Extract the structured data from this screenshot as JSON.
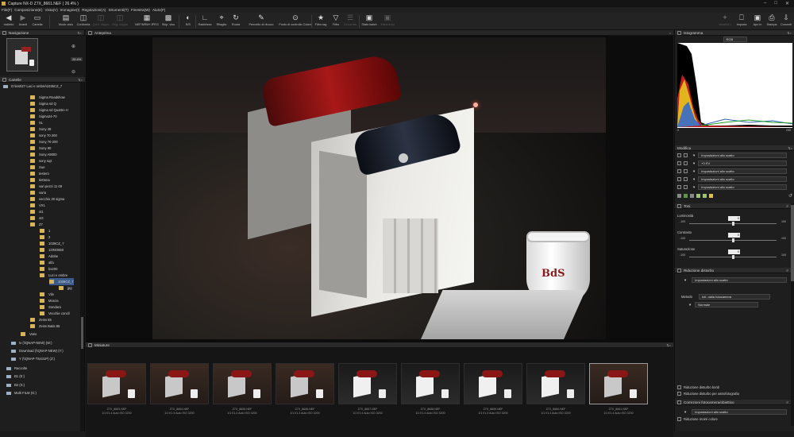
{
  "window": {
    "title": "Capture NX-D    Z7X_8661.NEF ( 26.4% )"
  },
  "menu": [
    "File(F)",
    "Composizione(E)",
    "Vista(V)",
    "Immagine(I)",
    "Regolazioni(A)",
    "Strumenti(T)",
    "Finestra(W)",
    "Aiuto(F)"
  ],
  "toolbar": {
    "items": [
      {
        "label": "Indietro",
        "icon": "back-arrow-icon"
      },
      {
        "label": "Avanti",
        "icon": "forward-arrow-icon"
      },
      {
        "label": "Cartella",
        "icon": "folder-icon"
      },
      {
        "label": "Modo visio",
        "icon": "view-mode-icon"
      },
      {
        "label": "Confronta",
        "icon": "compare-icon"
      },
      {
        "label": "Conf. doppo",
        "icon": "compare-double-icon"
      },
      {
        "label": "Orig. doppo",
        "icon": "original-double-icon"
      },
      {
        "label": "NEF/NRW+JPEG",
        "icon": "raw-jpeg-icon"
      },
      {
        "label": "Skip. visu",
        "icon": "skip-view-icon"
      },
      {
        "label": "B/S",
        "icon": "black-white-icon"
      },
      {
        "label": "Raddrizza",
        "icon": "straighten-icon"
      },
      {
        "label": "Ritaglia",
        "icon": "crop-icon"
      },
      {
        "label": "Ruota",
        "icon": "rotate-icon"
      },
      {
        "label": "Pennello di ritocco",
        "icon": "retouch-brush-icon"
      },
      {
        "label": "Punto di controllo Colore",
        "icon": "control-point-icon"
      },
      {
        "label": "Filtro tag",
        "icon": "star-tag-icon"
      },
      {
        "label": "Filtro",
        "icon": "filter-icon"
      },
      {
        "label": "Cerca dts",
        "icon": "search-data-icon"
      },
      {
        "label": "Stato batch",
        "icon": "batch-status-icon"
      },
      {
        "label": "Interrompi",
        "icon": "stop-icon"
      },
      {
        "label": "ViewNX-i",
        "icon": "viewnx-icon"
      },
      {
        "label": "Importa",
        "icon": "import-icon"
      },
      {
        "label": "Apri in",
        "icon": "open-in-icon"
      },
      {
        "label": "Stampa",
        "icon": "print-icon"
      },
      {
        "label": "Converti",
        "icon": "convert-icon"
      }
    ]
  },
  "left": {
    "nav_header": "Navigazione",
    "zoom": "26.4%",
    "folders_header": "Cartelle",
    "tree": [
      "D:\\test\\Z7 Luci e ombre\\1036CZ_7",
      "Sigma Roadshow",
      "Sigma sd Q",
      "Sigma sd Quattro H",
      "Sigma24-70",
      "SL",
      "Sony 28",
      "sony 70 200",
      "Sony 70-200",
      "Sony 90",
      "Sony A9000",
      "sony sqz",
      "Sue",
      "testero",
      "tiettona",
      "vari pezzi 11 09",
      "vario",
      "vecchio 30 sigma",
      "VX1",
      "xt1",
      "xt3",
      "Z7",
      "1",
      "2",
      "1036CZ_7",
      "12INO650",
      "Adobe",
      "alfa",
      "bx200",
      "Luci e ombre",
      "1036CZ_7",
      "jpg",
      "Vile",
      "Monza",
      "Sondara",
      "Vecchie concll",
      "Zeiss 85",
      "Zeiss Batis 85",
      "Varie",
      "Ix (\\\\QNAP-NEW) (W:)",
      "Download (\\\\QNAP-NEW) (Y:)",
      "Y (\\\\QNAP-TS431P) (Z:)",
      "Raccolte",
      "B1 (E:)",
      "B2 (S:)",
      "Multi FILM (G:)"
    ]
  },
  "center": {
    "viewer_header": "Anteprima",
    "filmstrip_header": "Miniature",
    "thumbs": [
      {
        "name": "Z7X_8653.NEF",
        "info": "1/1 f/1.4 Auto ISO 3200"
      },
      {
        "name": "Z7X_8654.NEF",
        "info": "1/1 f/1.4 Auto ISO 3200"
      },
      {
        "name": "Z7X_8655.NEF",
        "info": "1/1 f/1.4 Auto ISO 3200"
      },
      {
        "name": "Z7X_8656.NEF",
        "info": "1/1 f/1.4 Auto ISO 3200"
      },
      {
        "name": "Z7X_8657.NEF",
        "info": "1/1 f/1.4 Auto ISO 3200"
      },
      {
        "name": "Z7X_8658.NEF",
        "info": "1/1 f/1.4 Auto ISO 3200"
      },
      {
        "name": "Z7X_8659.NEF",
        "info": "1/1 f/1.4 Auto ISO 3200"
      },
      {
        "name": "Z7X_8660.NEF",
        "info": "1/1 f/1.4 Auto ISO 3200"
      },
      {
        "name": "Z7X_8661.NEF",
        "info": "1/1 f/1.4 Auto ISO 3200"
      }
    ],
    "photo_label": "BdS"
  },
  "right": {
    "histogram_header": "Istogramma",
    "hist_channel": "RGB",
    "hist_min": "0",
    "hist_max": "255",
    "adjust_header": "Modifica",
    "adjust_rows": [
      "Impostazioni allo scatto",
      "+0 EV",
      "Impostazioni allo scatto",
      "Impostazioni allo scatto",
      "Impostazioni allo scatto"
    ],
    "tone_header": "Toni",
    "tone": [
      {
        "label": "Luminosità",
        "min": "-100",
        "max": "100",
        "value": "0",
        "level": 0.5
      },
      {
        "label": "Contrasto",
        "min": "-100",
        "max": "100",
        "value": "0",
        "level": 0.5
      },
      {
        "label": "Saturazione",
        "min": "-100",
        "max": "100",
        "value": "0",
        "level": 0.5
      }
    ],
    "noise_header": "Riduzione disturbo",
    "noise_preset": "Impostazioni allo scatto",
    "noise_method_label": "Metodo",
    "noise_method": "Init. dalla fotocamera",
    "noise_sub": "Normale",
    "noise_checks": [
      "Riduzione disturbo bordi",
      "Riduzione disturbo per astrofotografia"
    ],
    "lens_header": "Correzioni fotocamera/obiettivo",
    "lens_preset": "Impostazioni allo scatto",
    "lens_check": "Riduzione moiré colore"
  },
  "colors": {
    "accent": "#3a5a8a",
    "folder": "#d9b45a"
  }
}
